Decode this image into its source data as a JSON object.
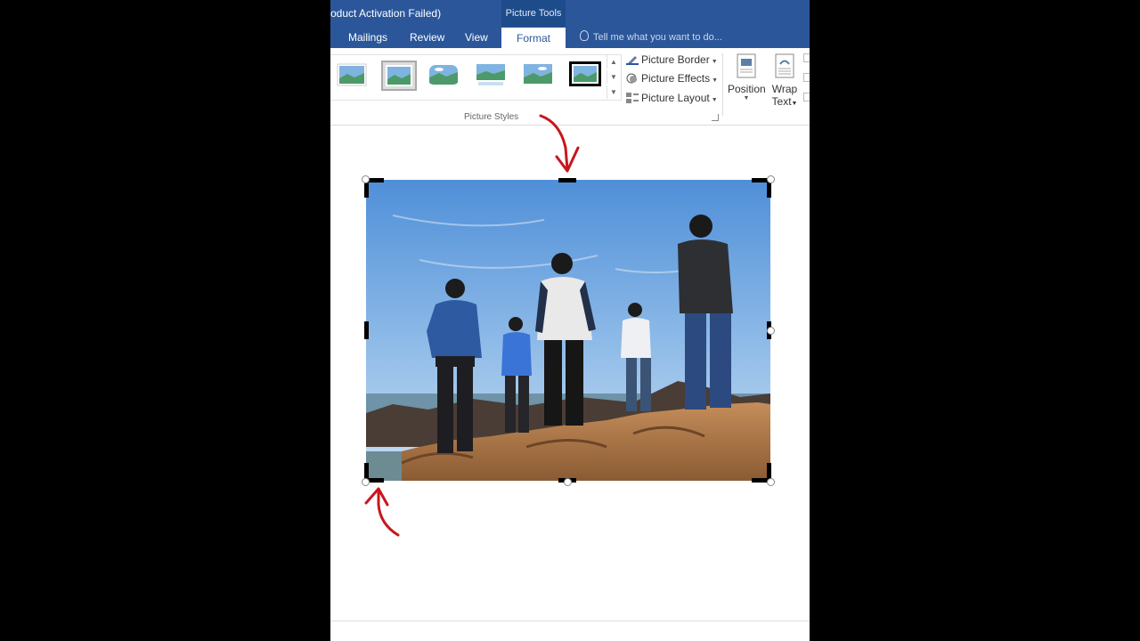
{
  "window": {
    "title_partial": "oduct Activation Failed)"
  },
  "context_tab_label": "Picture Tools",
  "tabs": [
    {
      "label": "Mailings",
      "active": false
    },
    {
      "label": "Review",
      "active": false
    },
    {
      "label": "View",
      "active": false
    },
    {
      "label": "Format",
      "active": true
    }
  ],
  "tell_me": {
    "placeholder": "Tell me what you want to do..."
  },
  "ribbon": {
    "picture_styles": {
      "group_label": "Picture Styles",
      "style_count": 6,
      "commands": [
        {
          "label": "Picture Border",
          "icon": "pencil-icon"
        },
        {
          "label": "Picture Effects",
          "icon": "effects-icon"
        },
        {
          "label": "Picture Layout",
          "icon": "layout-icon"
        }
      ]
    },
    "arrange": {
      "position_label": "Position",
      "wrap_label_1": "Wrap",
      "wrap_label_2": "Text"
    }
  },
  "colors": {
    "accent": "#2b579a",
    "annotation_arrow": "#c8161d",
    "sky": "#5d95d6",
    "rock": "#b07a4a"
  }
}
